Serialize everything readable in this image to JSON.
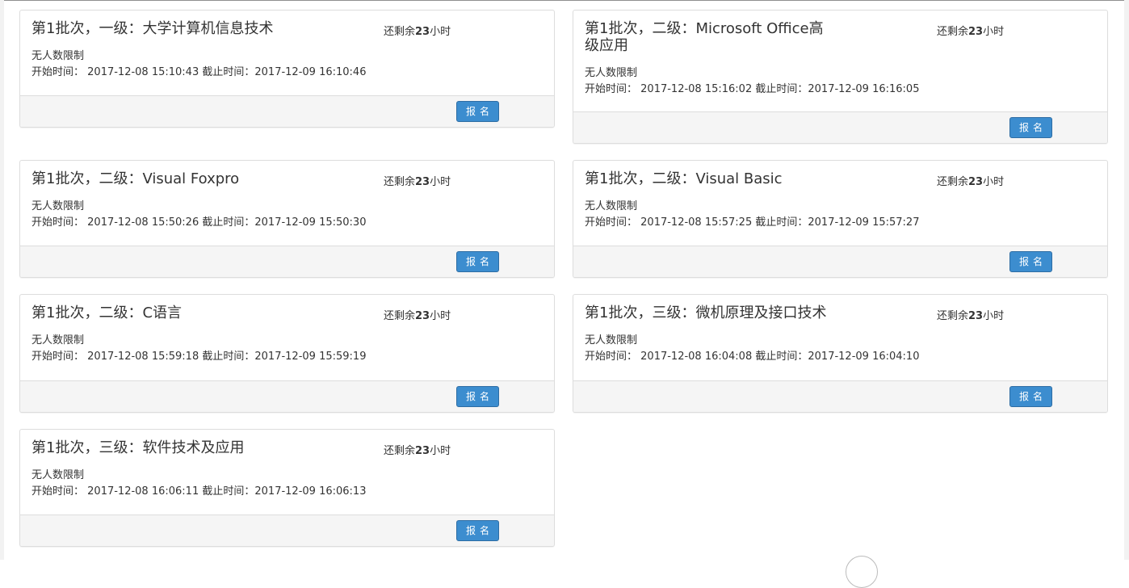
{
  "cards": [
    {
      "title": "第1批次，一级：大学计算机信息技术",
      "remain_prefix": "还剩余",
      "remain_number": "23",
      "remain_unit": "小时",
      "limit": "无人数限制",
      "start_label": "开始时间：",
      "start_time": "2017-12-08 15:10:43",
      "end_label": "截止时间：",
      "end_time": "2017-12-09 16:10:46",
      "button": "报名"
    },
    {
      "title": "第1批次，二级：Microsoft Office高级应用",
      "remain_prefix": "还剩余",
      "remain_number": "23",
      "remain_unit": "小时",
      "limit": "无人数限制",
      "start_label": "开始时间：",
      "start_time": "2017-12-08 15:16:02",
      "end_label": "截止时间：",
      "end_time": "2017-12-09 16:16:05",
      "button": "报名"
    },
    {
      "title": "第1批次，二级：Visual Foxpro",
      "remain_prefix": "还剩余",
      "remain_number": "23",
      "remain_unit": "小时",
      "limit": "无人数限制",
      "start_label": "开始时间：",
      "start_time": "2017-12-08 15:50:26",
      "end_label": "截止时间：",
      "end_time": "2017-12-09 15:50:30",
      "button": "报名"
    },
    {
      "title": "第1批次，二级：Visual Basic",
      "remain_prefix": "还剩余",
      "remain_number": "23",
      "remain_unit": "小时",
      "limit": "无人数限制",
      "start_label": "开始时间：",
      "start_time": "2017-12-08 15:57:25",
      "end_label": "截止时间：",
      "end_time": "2017-12-09 15:57:27",
      "button": "报名"
    },
    {
      "title": "第1批次，二级：C语言",
      "remain_prefix": "还剩余",
      "remain_number": "23",
      "remain_unit": "小时",
      "limit": "无人数限制",
      "start_label": "开始时间：",
      "start_time": "2017-12-08 15:59:18",
      "end_label": "截止时间：",
      "end_time": "2017-12-09 15:59:19",
      "button": "报名"
    },
    {
      "title": "第1批次，三级：微机原理及接口技术",
      "remain_prefix": "还剩余",
      "remain_number": "23",
      "remain_unit": "小时",
      "limit": "无人数限制",
      "start_label": "开始时间：",
      "start_time": "2017-12-08 16:04:08",
      "end_label": "截止时间：",
      "end_time": "2017-12-09 16:04:10",
      "button": "报名"
    },
    {
      "title": "第1批次，三级：软件技术及应用",
      "remain_prefix": "还剩余",
      "remain_number": "23",
      "remain_unit": "小时",
      "limit": "无人数限制",
      "start_label": "开始时间：",
      "start_time": "2017-12-08 16:06:11",
      "end_label": "截止时间：",
      "end_time": "2017-12-09 16:06:13",
      "button": "报名"
    }
  ],
  "colors": {
    "button_bg": "#3c8dcf",
    "footer_bg": "#f5f5f5",
    "border": "#dddddd"
  }
}
